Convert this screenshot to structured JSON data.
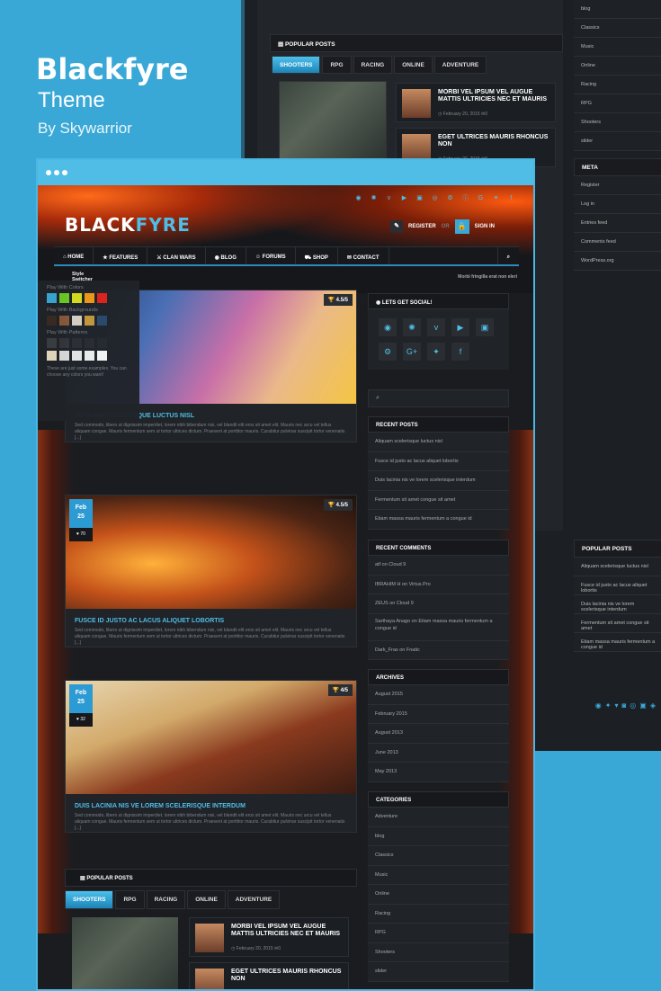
{
  "hero": {
    "title": "Blackfyre",
    "subtitle": "Theme",
    "by": "By Skywarrior"
  },
  "brand": {
    "logo_main": "BLACK",
    "logo_accent": "FYRE",
    "accent": "#3aa8d6"
  },
  "header": {
    "register": "REGISTER",
    "or": "OR",
    "signin": "SIGN IN"
  },
  "nav": [
    "HOME",
    "FEATURES",
    "CLAN WARS",
    "BLOG",
    "FORUMS",
    "SHOP",
    "CONTACT"
  ],
  "ticker": "Morbi fringilla erat non eleri",
  "style_switcher": {
    "title": "Style Switcher",
    "colors_label": "Play With Colors",
    "backgrounds_label": "Play With Backgrounds",
    "patterns_label": "Play With Patterns",
    "note": "These are just some examples. You can choose any colors you want!",
    "colors": [
      "#3aa8d6",
      "#6ccd23",
      "#d8e11c",
      "#f39b14",
      "#e2231a"
    ]
  },
  "posts": [
    {
      "title": "ALIQUAM SCELERISQUE LUCTUS NISL",
      "rating": "4.5/5",
      "excerpt": "Sed commodo, libero ut dignissim imperdiet, lorem nibh bibendum nisi, vel blandit elit eros sit amet elit. Mauris nec arcu vel tellus aliquam congue. Mauris fermentum sem ut tortor ultrices dictum. Praesent at porttitor mauris. Curabitur pulvinar suscipit tortor venenatis [...]"
    },
    {
      "title": "FUSCE ID JUSTO AC LACUS ALIQUET LOBORTIS",
      "rating": "4.5/5",
      "month": "Feb",
      "day": "25",
      "likes": "70",
      "excerpt": "Sed commodo, libero ut dignissim imperdiet, lorem nibh bibendum nisi, vel blandit elit eros sit amet elit. Mauris nec arcu vel tellus aliquam congue. Mauris fermentum sem ut tortor ultrices dictum. Praesent at porttitor mauris. Curabitur pulvinar suscipit tortor venenatis [...]"
    },
    {
      "title": "DUIS LACINIA NIS VE LOREM SCELERISQUE INTERDUM",
      "rating": "4/5",
      "month": "Feb",
      "day": "25",
      "likes": "32",
      "excerpt": "Sed commodo, libero ut dignissim imperdiet, lorem nibh bibendum nisi, vel blandit elit eros sit amet elit. Mauris nec arcu vel tellus aliquam congue. Mauris fermentum sem ut tortor ultrices dictum. Praesent at porttitor mauris. Curabitur pulvinar suscipit tortor venenatis [...]"
    }
  ],
  "sidebar": {
    "social_title": "LETS GET SOCIAL!",
    "recent_posts_title": "RECENT POSTS",
    "recent_posts": [
      "Aliquam scelerisque luctus nisl",
      "Fusce id justo ac lacus aliquet lobortis",
      "Duis lacinia nis ve lorem scelerisque interdum",
      "Fermentum sit amet congue sit amet",
      "Etiam massa mauris fermentum a congue id"
    ],
    "recent_comments_title": "RECENT COMMENTS",
    "recent_comments": [
      "atf on Cloud 9",
      "IBRAHIM H on Virtus.Pro",
      "ZEUS on Cloud 9",
      "Sarthaya Anago on Etiam massa mauris fermentum a congue id",
      "Dark_Fras on Fnatic"
    ],
    "archives_title": "ARCHIVES",
    "archives": [
      "August 2015",
      "February 2015",
      "August 2013",
      "June 2013",
      "May 2013"
    ],
    "categories_title": "CATEGORIES",
    "categories": [
      "Adventure",
      "blog",
      "Classics",
      "Music",
      "Online",
      "Racing",
      "RPG",
      "Shooters",
      "slider"
    ],
    "meta_title": "META",
    "meta": [
      "Register",
      "Log in",
      "Entries feed",
      "Comments feed",
      "WordPress.org"
    ],
    "popular_title": "POPULAR POSTS"
  },
  "popular": {
    "title": "POPULAR POSTS",
    "tabs": [
      "SHOOTERS",
      "RPG",
      "RACING",
      "ONLINE",
      "ADVENTURE"
    ],
    "items": [
      {
        "title": "MORBI VEL IPSUM VEL AUGUE MATTIS ULTRICIES NEC ET MAURIS",
        "date": "February 20, 2015",
        "comments": "0"
      },
      {
        "title": "EGET ULTRICES MAURIS RHONCUS NON",
        "date": "February 20, 2015",
        "comments": "0"
      }
    ]
  }
}
